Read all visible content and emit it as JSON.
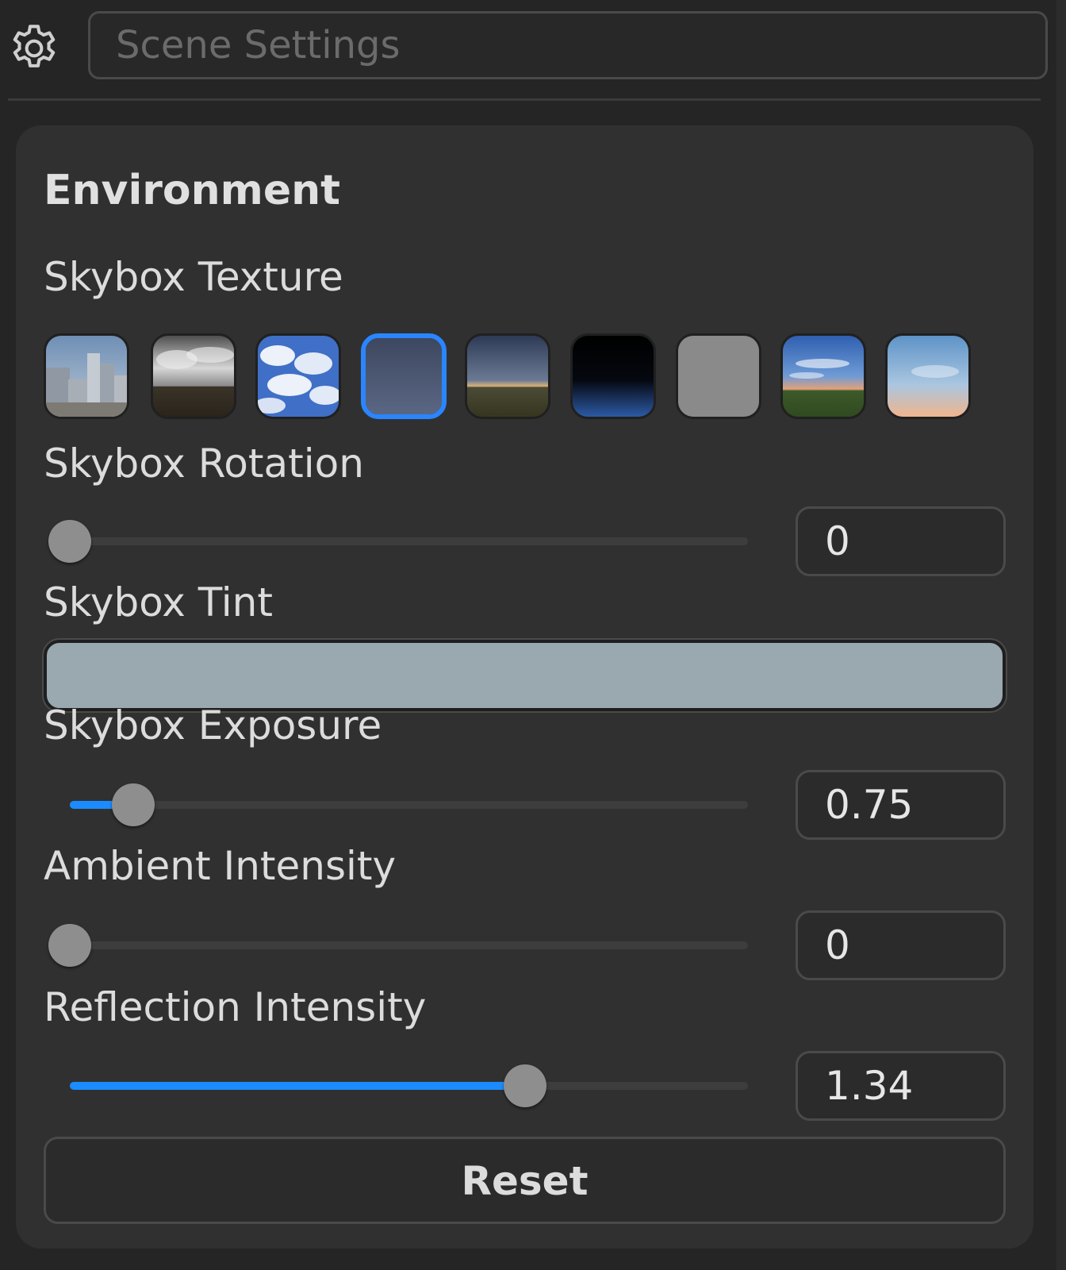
{
  "header": {
    "search_placeholder": "Scene Settings"
  },
  "section": {
    "title": "Environment"
  },
  "skybox_texture": {
    "label": "Skybox Texture",
    "selected_index": 3,
    "options": [
      "city-skybox",
      "overcast-skybox",
      "cloudy-sky-skybox",
      "night-sky-skybox",
      "dusk-field-skybox",
      "space-skybox",
      "gray-skybox",
      "sunset-field-skybox",
      "pastel-sky-skybox"
    ]
  },
  "skybox_rotation": {
    "label": "Skybox Rotation",
    "value": "0",
    "fraction": 0
  },
  "skybox_tint": {
    "label": "Skybox Tint",
    "color": "#9aa8b0"
  },
  "skybox_exposure": {
    "label": "Skybox Exposure",
    "value": "0.75",
    "fraction": 0.094
  },
  "ambient_intensity": {
    "label": "Ambient Intensity",
    "value": "0",
    "fraction": 0
  },
  "reflection_intensity": {
    "label": "Reflection Intensity",
    "value": "1.34",
    "fraction": 0.67
  },
  "actions": {
    "reset_label": "Reset"
  },
  "colors": {
    "accent": "#1b8cff",
    "panel": "#303030",
    "background": "#252525"
  }
}
